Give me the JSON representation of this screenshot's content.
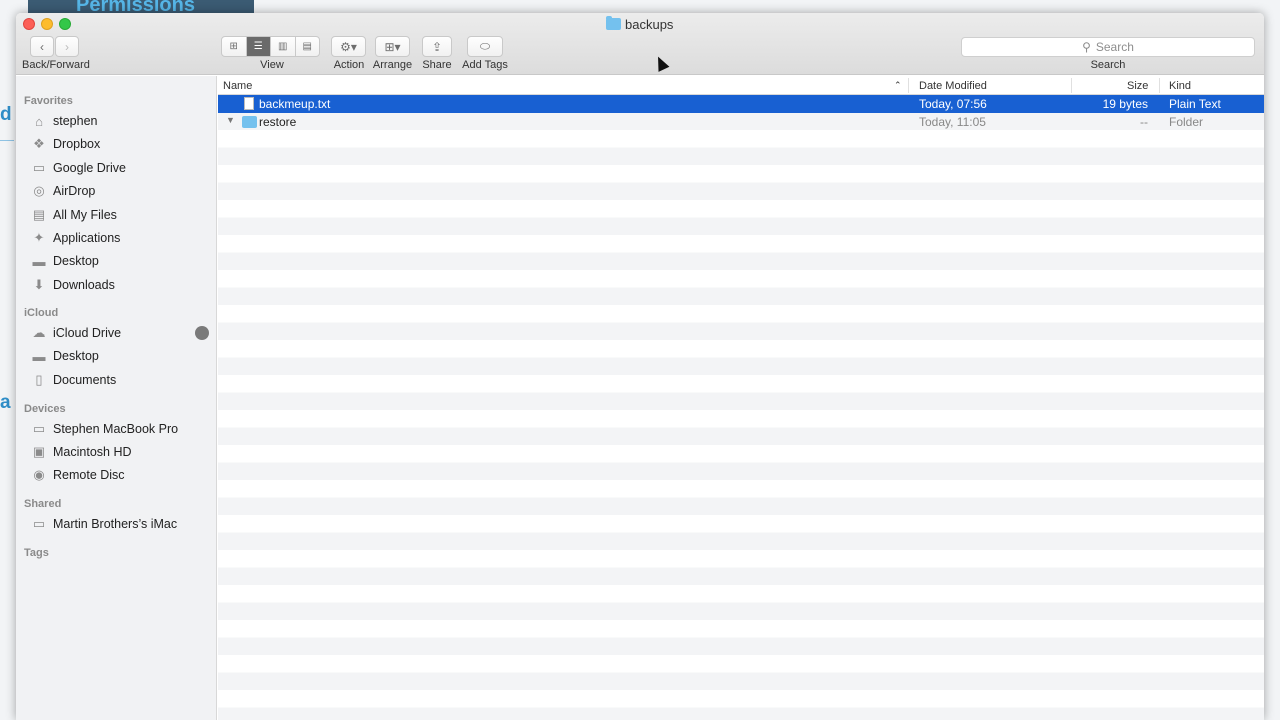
{
  "background": {
    "banner_text": "Permissions",
    "left_letters": [
      "d",
      "a"
    ]
  },
  "window": {
    "title": "backups",
    "folder_color": "#74c1ee"
  },
  "toolbar": {
    "back_forward_label": "Back/Forward",
    "view_label": "View",
    "action_label": "Action",
    "arrange_label": "Arrange",
    "share_label": "Share",
    "add_tags_label": "Add Tags",
    "search_label": "Search",
    "search_placeholder": "Search"
  },
  "sidebar": {
    "favorites_header": "Favorites",
    "favorites": [
      {
        "label": "stephen",
        "icon": "home-icon"
      },
      {
        "label": "Dropbox",
        "icon": "dropbox-icon"
      },
      {
        "label": "Google Drive",
        "icon": "folder-icon"
      },
      {
        "label": "AirDrop",
        "icon": "airdrop-icon"
      },
      {
        "label": "All My Files",
        "icon": "all-files-icon"
      },
      {
        "label": "Applications",
        "icon": "applications-icon"
      },
      {
        "label": "Desktop",
        "icon": "desktop-icon"
      },
      {
        "label": "Downloads",
        "icon": "downloads-icon"
      }
    ],
    "icloud_header": "iCloud",
    "icloud": [
      {
        "label": "iCloud Drive",
        "icon": "cloud-icon"
      },
      {
        "label": "Desktop",
        "icon": "desktop-icon"
      },
      {
        "label": "Documents",
        "icon": "documents-icon"
      }
    ],
    "devices_header": "Devices",
    "devices": [
      {
        "label": "Stephen MacBook Pro",
        "icon": "laptop-icon"
      },
      {
        "label": "Macintosh HD",
        "icon": "disk-icon"
      },
      {
        "label": "Remote Disc",
        "icon": "disc-icon"
      }
    ],
    "shared_header": "Shared",
    "shared": [
      {
        "label": "Martin Brothers’s iMac",
        "icon": "imac-icon"
      }
    ],
    "tags_header": "Tags"
  },
  "columns": {
    "name": "Name",
    "date_modified": "Date Modified",
    "size": "Size",
    "kind": "Kind"
  },
  "files": [
    {
      "name": "backmeup.txt",
      "date": "Today, 07:56",
      "size": "19 bytes",
      "kind": "Plain Text",
      "selected": true
    },
    {
      "name": "restore",
      "date": "Today, 11:05",
      "size": "--",
      "kind": "Folder",
      "selected": false
    }
  ],
  "colors": {
    "selection": "#1860d2",
    "close": "#fc5f57",
    "minimize": "#fdbc2e",
    "maximize": "#33c748"
  }
}
